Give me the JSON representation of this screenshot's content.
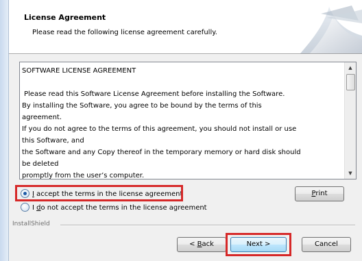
{
  "header": {
    "title": "License Agreement",
    "subtitle": "Please read the following license agreement carefully."
  },
  "license": {
    "lines": [
      "SOFTWARE LICENSE AGREEMENT",
      "",
      " Please read this Software License Agreement before installing the Software.",
      "By installing the Software, you agree to be bound by the terms of this",
      "agreement.",
      "If you do not agree to the terms of this agreement, you should not install or use",
      "this Software, and",
      "the Software and any Copy thereof in the temporary memory or hard disk should",
      "be deleted",
      "promptly from the user’s computer."
    ]
  },
  "options": {
    "accept": {
      "mnemonic": "I",
      "rest": " accept the terms in the license agreement",
      "selected": true
    },
    "decline": {
      "prefix": "I ",
      "mnemonic": "d",
      "rest": "o not accept the terms in the license agreement",
      "selected": false
    }
  },
  "buttons": {
    "print": {
      "mnemonic": "P",
      "rest": "rint"
    },
    "back": {
      "prefix": "< ",
      "mnemonic": "B",
      "rest": "ack"
    },
    "next": "Next >",
    "cancel": "Cancel"
  },
  "footer": {
    "brand": "InstallShield"
  },
  "colors": {
    "highlight": "#d62828",
    "header_bg": "#ffffff",
    "dialog_bg": "#f0f0f0"
  },
  "icons": [
    "scroll-up-arrow-icon",
    "scroll-down-arrow-icon",
    "radio-checked-icon",
    "radio-unchecked-icon",
    "installshield-banner-art"
  ]
}
